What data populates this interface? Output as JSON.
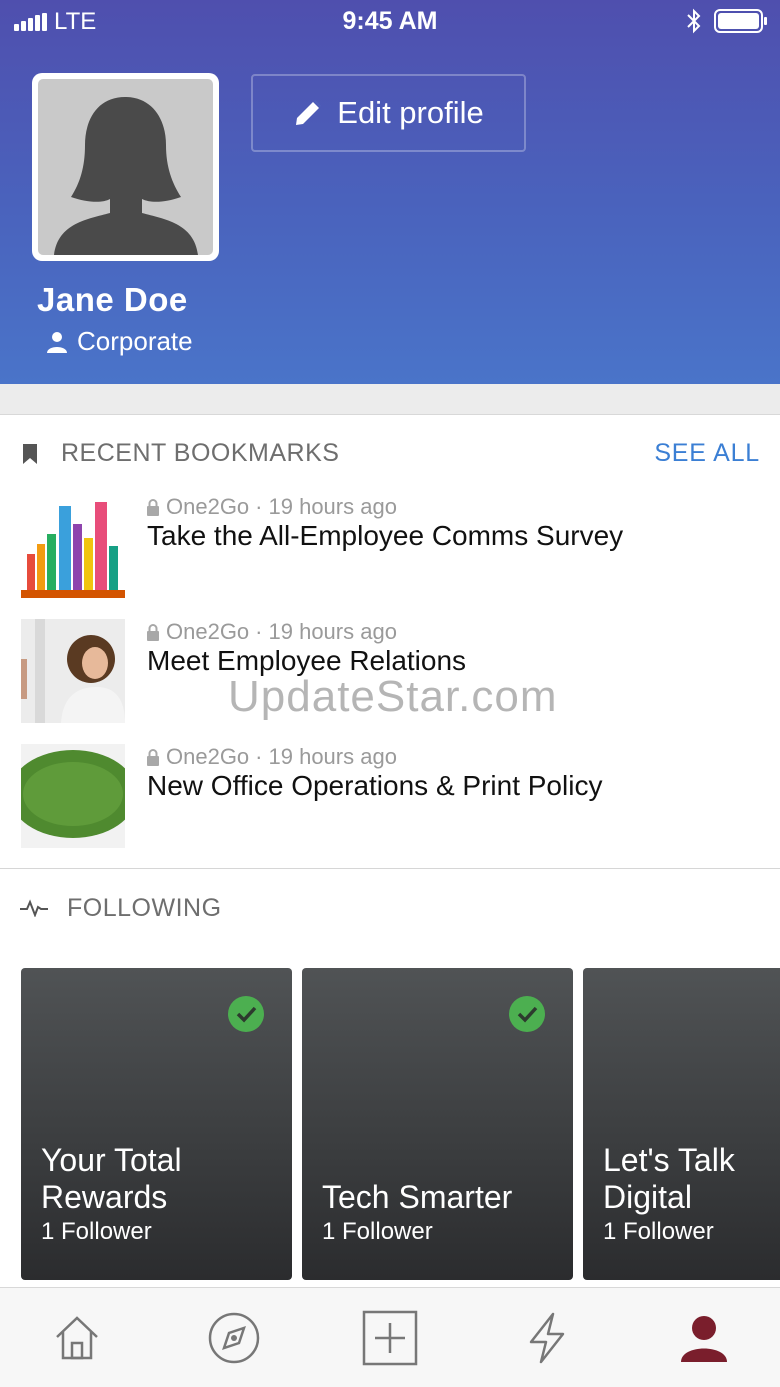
{
  "status_bar": {
    "carrier": "LTE",
    "time": "9:45 AM"
  },
  "profile": {
    "edit_label": "Edit profile",
    "name": "Jane Doe",
    "group": "Corporate"
  },
  "bookmarks": {
    "title": "RECENT BOOKMARKS",
    "see_all": "SEE ALL",
    "items": [
      {
        "source": "One2Go",
        "time": "19 hours ago",
        "title": "Take the All-Employee Comms Survey"
      },
      {
        "source": "One2Go",
        "time": "19 hours ago",
        "title": "Meet Employee Relations"
      },
      {
        "source": "One2Go",
        "time": "19 hours ago",
        "title": "New Office Operations & Print Policy"
      }
    ],
    "separator": "·"
  },
  "following": {
    "title": "FOLLOWING",
    "cards": [
      {
        "title_line1": "Your Total",
        "title_line2": "Rewards",
        "followers": "1 Follower",
        "followed": true
      },
      {
        "title_line1": "",
        "title_line2": "Tech Smarter",
        "followers": "1 Follower",
        "followed": true
      },
      {
        "title_line1": "Let's Talk",
        "title_line2": "Digital",
        "followers": "1 Follower",
        "followed": false
      }
    ]
  },
  "watermark": "UpdateStar.com",
  "tabbar": {
    "items": [
      "home-icon",
      "compass-icon",
      "plus-square-icon",
      "lightning-icon",
      "profile-icon"
    ],
    "active": "profile-icon",
    "active_color": "#7a1e2c"
  },
  "colors": {
    "header_gradient_start": "#4f4fae",
    "header_gradient_end": "#4a74c9",
    "accent_link": "#3b7fd4",
    "check_green": "#4caf50"
  }
}
